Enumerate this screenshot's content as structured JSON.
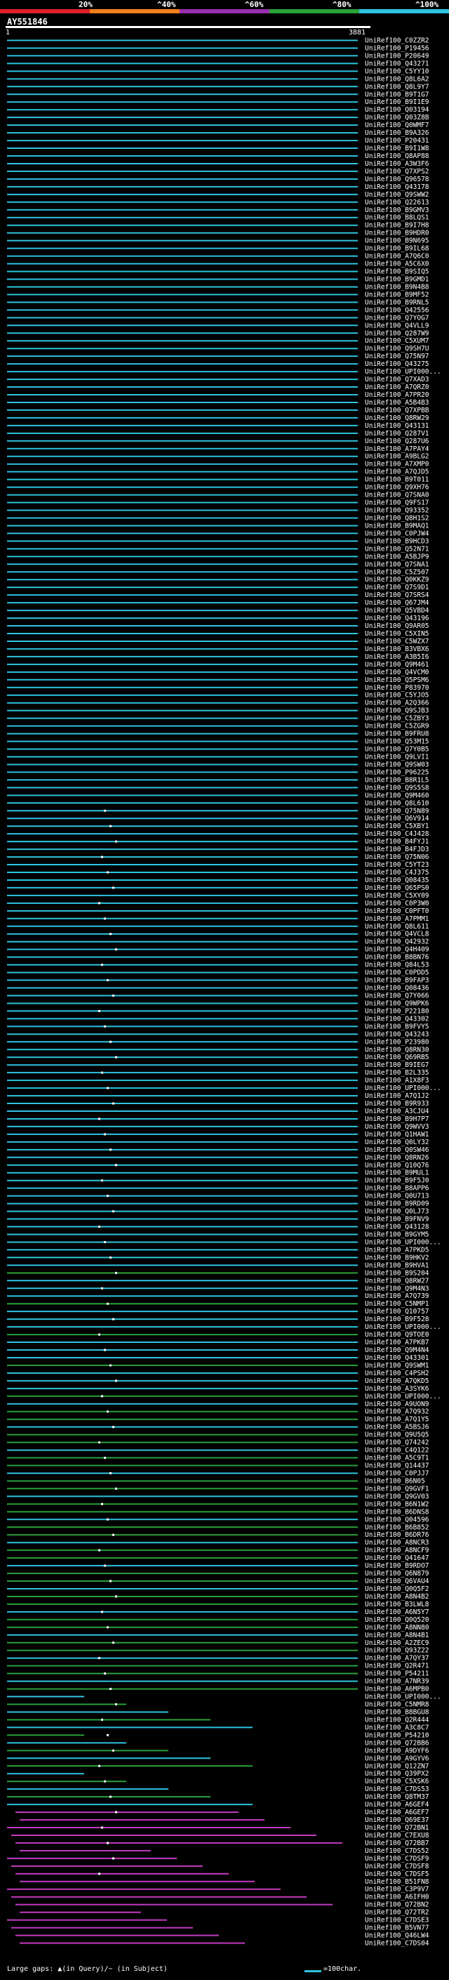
{
  "header": {
    "query_id": "AY551846",
    "ruler_start": "1",
    "ruler_end": "3881",
    "legend": [
      {
        "label": "20%",
        "color": "#e0202a"
      },
      {
        "label": "^40%",
        "color": "#f07f1e"
      },
      {
        "label": "^60%",
        "color": "#9a2fb0"
      },
      {
        "label": "^80%",
        "color": "#2aa13a"
      },
      {
        "label": "^100%",
        "color": "#2ec4e0"
      }
    ]
  },
  "footer": {
    "large_gaps_text": "Large gaps: ▲(in Query)/~ (in Subject)",
    "scale_text": "=100char."
  },
  "hits": [
    "UniRef100_C0ZZR2",
    "UniRef100_P19456",
    "UniRef100_P20649",
    "UniRef100_Q43271",
    "UniRef100_C5YY10",
    "UniRef100_Q8L6A2",
    "UniRef100_Q8L9Y7",
    "UniRef100_B9T1G7",
    "UniRef100_B9I1E9",
    "UniRef100_Q03194",
    "UniRef100_Q03Z8B",
    "UniRef100_Q0WMF7",
    "UniRef100_B9A326",
    "UniRef100_P20431",
    "UniRef100_B9I1W8",
    "UniRef100_Q8AP88",
    "UniRef100_A3W3F6",
    "UniRef100_Q7XPS2",
    "UniRef100_Q96578",
    "UniRef100_Q43178",
    "UniRef100_Q9SWW2",
    "UniRef100_Q22613",
    "UniRef100_B9GMV3",
    "UniRef100_B8LQS1",
    "UniRef100_B9I7H8",
    "UniRef100_B9HDR0",
    "UniRef100_B9N695",
    "UniRef100_B9IL68",
    "UniRef100_A7Q6C0",
    "UniRef100_A5C6X0",
    "UniRef100_B9SIQ5",
    "UniRef100_B9GMD1",
    "UniRef100_B9N4B8",
    "UniRef100_B9MF52",
    "UniRef100_B9RNL5",
    "UniRef100_Q42556",
    "UniRef100_Q7YOG7",
    "UniRef100_Q4VLL9",
    "UniRef100_Q287W9",
    "UniRef100_C5XUM7",
    "UniRef100_Q9SH7U",
    "UniRef100_Q75N97",
    "UniRef100_Q43275",
    "UniRef100_UPI000...",
    "UniRef100_Q7XAD3",
    "UniRef100_A7QRZ0",
    "UniRef100_A7PR20",
    "UniRef100_A5B4B3",
    "UniRef100_Q7XPBB",
    "UniRef100_Q8RW29",
    "UniRef100_Q43131",
    "UniRef100_Q287V1",
    "UniRef100_Q287U6",
    "UniRef100_A7PAY4",
    "UniRef100_A9BLG2",
    "UniRef100_A7XMP0",
    "UniRef100_A7QJD5",
    "UniRef100_B9T011",
    "UniRef100_Q9XH76",
    "UniRef100_Q7SNA0",
    "UniRef100_Q9FS17",
    "UniRef100_Q93352",
    "UniRef100_Q8H1S2",
    "UniRef100_B9MAQ1",
    "UniRef100_C0PJW4",
    "UniRef100_B9HCD3",
    "UniRef100_Q52N71",
    "UniRef100_A5BJP9",
    "UniRef100_Q7SNA1",
    "UniRef100_C5Z507",
    "UniRef100_Q0KKZ9",
    "UniRef100_Q7S9D1",
    "UniRef100_Q7SRS4",
    "UniRef100_Q67JM4",
    "UniRef100_Q5VBD4",
    "UniRef100_Q43196",
    "UniRef100_Q9AR05",
    "UniRef100_C5XIN5",
    "UniRef100_C5WZX7",
    "UniRef100_B3VBX6",
    "UniRef100_A3B5I6",
    "UniRef100_Q9M461",
    "UniRef100_Q4VCM0",
    "UniRef100_Q5PSM6",
    "UniRef100_P83970",
    "UniRef100_C5YJO5",
    "UniRef100_A2Q366",
    "UniRef100_Q9SJB3",
    "UniRef100_C5ZBY3",
    "UniRef100_C5ZGR9",
    "UniRef100_B9FRU8",
    "UniRef100_Q53M15",
    "UniRef100_Q7Y0B5",
    "UniRef100_Q9LVI1",
    "UniRef100_Q9SW03",
    "UniRef100_P96225",
    "UniRef100_B8R1L5",
    "UniRef100_Q9S5S8",
    "UniRef100_Q9M460",
    "UniRef100_Q8L610",
    "UniRef100_Q75N89",
    "UniRef100_Q6V914",
    "UniRef100_C5XBY1",
    "UniRef100_C4J428",
    "UniRef100_B4FYJ1",
    "UniRef100_B4FJD3",
    "UniRef100_Q75N06",
    "UniRef100_C5YT23",
    "UniRef100_C4J375",
    "UniRef100_Q08435",
    "UniRef100_Q65PS0",
    "UniRef100_C5XY09",
    "UniRef100_C0P3W0",
    "UniRef100_C0PFT0",
    "UniRef100_A7PMM1",
    "UniRef100_Q8L611",
    "UniRef100_Q4VCL8",
    "UniRef100_Q42932",
    "UniRef100_Q4H409",
    "UniRef100_B8BN76",
    "UniRef100_Q84L53",
    "UniRef100_C0PDD5",
    "UniRef100_B9FAP3",
    "UniRef100_Q08436",
    "UniRef100_Q7Y066",
    "UniRef100_Q9WPK6",
    "UniRef100_P22180",
    "UniRef100_Q43302",
    "UniRef100_B9FVY5",
    "UniRef100_Q43243",
    "UniRef100_P23980",
    "UniRef100_Q8RN30",
    "UniRef100_Q69RB5",
    "UniRef100_B9IEG7",
    "UniRef100_B2L335",
    "UniRef100_A1X8F3",
    "UniRef100_UPI000...",
    "UniRef100_A7Q1J2",
    "UniRef100_B9R933",
    "UniRef100_A3CJU4",
    "UniRef100_B9H7P7",
    "UniRef100_Q9WVV3",
    "UniRef100_Q1HAW1",
    "UniRef100_Q0LY32",
    "UniRef100_Q0SW46",
    "UniRef100_Q8RN26",
    "UniRef100_Q10Q76",
    "UniRef100_B9MUL1",
    "UniRef100_B9F5J0",
    "UniRef100_B8APP6",
    "UniRef100_Q0U713",
    "UniRef100_B9RD09",
    "UniRef100_Q0LJ73",
    "UniRef100_B9FNV9",
    "UniRef100_Q43128",
    "UniRef100_B9GYM5",
    "UniRef100_UPI000...",
    "UniRef100_A7PKD5",
    "UniRef100_B9HKV2",
    "UniRef100_B9HVA1",
    "UniRef100_B9S204",
    "UniRef100_Q8RW27",
    "UniRef100_Q9M4N3",
    "UniRef100_A7Q739",
    "UniRef100_C5NMP1",
    "UniRef100_Q10757",
    "UniRef100_B9F528",
    "UniRef100_UPI000...",
    "UniRef100_Q9TOE0",
    "UniRef100_A7PKB7",
    "UniRef100_Q9M4N4",
    "UniRef100_Q43301",
    "UniRef100_Q9SWM1",
    "UniRef100_C4PSH2",
    "UniRef100_A7QKD5",
    "UniRef100_A3SYK6",
    "UniRef100_UPI000...",
    "UniRef100_A9UON9",
    "UniRef100_A7Q932",
    "UniRef100_A7Q1Y5",
    "UniRef100_A5BSJ6",
    "UniRef100_Q9U5Q5",
    "UniRef100_Q74242",
    "UniRef100_C4Q122",
    "UniRef100_A5C9T1",
    "UniRef100_Q14437",
    "UniRef100_C0PJJ7",
    "UniRef100_B6N05",
    "UniRef100_Q9GVF1",
    "UniRef100_Q9GV03",
    "UniRef100_B6N1W2",
    "UniRef100_B6DNS8",
    "UniRef100_Q04596",
    "UniRef100_B6B852",
    "UniRef100_B6DR76",
    "UniRef100_A8NCR3",
    "UniRef100_A8NCF9",
    "UniRef100_Q41647",
    "UniRef100_B9RDO7",
    "UniRef100_Q6N879",
    "UniRef100_Q6VAU4",
    "UniRef100_Q0Q5F2",
    "UniRef100_A8N4B2",
    "UniRef100_B3LWL8",
    "UniRef100_A6N5Y7",
    "UniRef100_Q0Q520",
    "UniRef100_A8NN80",
    "UniRef100_A8N4B1",
    "UniRef100_A2ZEC9",
    "UniRef100_Q93Z22",
    "UniRef100_A7QY37",
    "UniRef100_Q2R471",
    "UniRef100_P54211",
    "UniRef100_A7NR39",
    "UniRef100_A6MPB0",
    "UniRef100_UPI000...",
    "UniRef100_C5NMR8",
    "UniRef100_B8BGU8",
    "UniRef100_Q2R444",
    "UniRef100_A3C8C7",
    "UniRef100_P54210",
    "UniRef100_Q72BB6",
    "UniRef100_A9DYF6",
    "UniRef100_A9GYV6",
    "UniRef100_Q12ZN7",
    "UniRef100_Q39PX2",
    "UniRef100_C5XSK6",
    "UniRef100_C7DS53",
    "UniRef100_Q8TM37",
    "UniRef100_A6GEF4",
    "UniRef100_A6GEF7",
    "UniRef100_Q69E37",
    "UniRef100_Q72BN1",
    "UniRef100_C7EXU8",
    "UniRef100_Q72BB7",
    "UniRef100_C7DS52",
    "UniRef100_C7DSF9",
    "UniRef100_C7DSF8",
    "UniRef100_C7DSF5",
    "UniRef100_B51FN8",
    "UniRef100_C3P9V7",
    "UniRef100_A6IFH0",
    "UniRef100_Q72BN2",
    "UniRef100_Q72TR2",
    "UniRef100_C7DSE3",
    "UniRef100_B5VN77",
    "UniRef100_Q46LW4",
    "UniRef100_C7DS04"
  ]
}
